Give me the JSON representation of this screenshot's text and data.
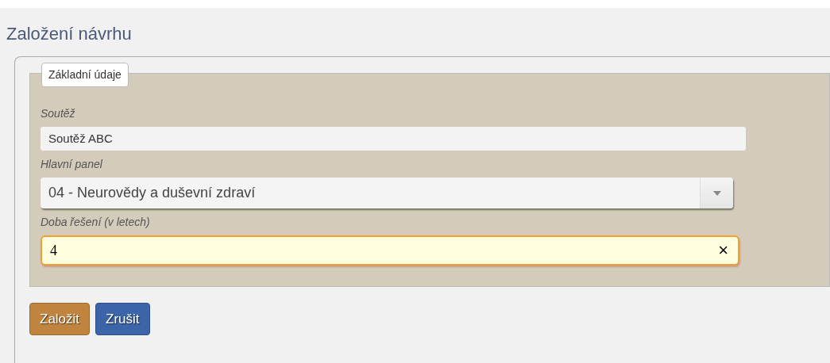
{
  "title": "Založení návrhu",
  "fieldset": {
    "legend": "Základní údaje",
    "fields": [
      {
        "kind": "readonly",
        "label": "Soutěž",
        "value": "Soutěž ABC"
      },
      {
        "kind": "select",
        "label": "Hlavní panel",
        "value": "04 - Neurovědy a duševní zdraví"
      },
      {
        "kind": "input",
        "label": "Doba řešení (v letech)",
        "value": "4",
        "clear": "×"
      }
    ]
  },
  "buttons": [
    {
      "kind": "primary",
      "label": "Založit"
    },
    {
      "kind": "secondary",
      "label": "Zrušit"
    }
  ]
}
